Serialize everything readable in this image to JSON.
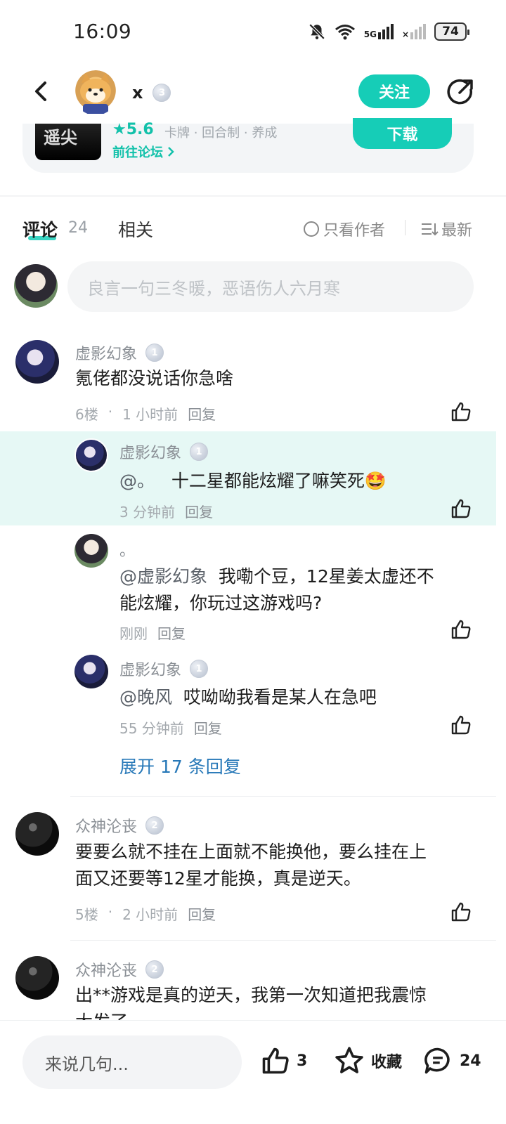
{
  "status": {
    "time": "16:09",
    "network": "5G",
    "battery": "74"
  },
  "header": {
    "user_name": "x",
    "level": "3",
    "follow_label": "关注"
  },
  "game": {
    "thumb_text": "遥尖",
    "rating": "★5.6",
    "tags": "卡牌 · 回合制 · 养成",
    "forum_link": "前往论坛",
    "download_label": "下载"
  },
  "tabs": {
    "comments_label": "评论",
    "comments_count": "24",
    "related_label": "相关",
    "author_only_label": "只看作者",
    "sort_label": "最新"
  },
  "composer": {
    "placeholder": "良言一句三冬暖，恶语伤人六月寒"
  },
  "comments": [
    {
      "user": "虚影幻象",
      "level": "1",
      "text": "氪佬都没说话你急啥",
      "floor": "6楼",
      "time": "1 小时前",
      "reply": "回复",
      "replies": [
        {
          "user": "虚影幻象",
          "level": "1",
          "mention": "@。",
          "text": "十二星都能炫耀了嘛笑死🤩",
          "time": "3 分钟前",
          "reply": "回复"
        },
        {
          "user": "。",
          "mention": "@虚影幻象",
          "text_line1": "我嘞个豆，12星姜太虚还不",
          "text_line2": "能炫耀，你玩过这游戏吗?",
          "time": "刚刚",
          "reply": "回复"
        },
        {
          "user": "虚影幻象",
          "level": "1",
          "mention": "@晚风",
          "text": "哎呦呦我看是某人在急吧",
          "time": "55 分钟前",
          "reply": "回复"
        }
      ],
      "expand_label": "展开 17 条回复"
    },
    {
      "user": "众神沦丧",
      "level": "2",
      "text_line1": "要要么就不挂在上面就不能换他，要么挂在上",
      "text_line2": "面又还要等12星才能换，真是逆天。",
      "floor": "5楼",
      "time": "2 小时前",
      "reply": "回复"
    },
    {
      "user": "众神沦丧",
      "level": "2",
      "text_line1": "出**游戏是真的逆天，我第一次知道把我震惊",
      "text_line2": "大发了"
    }
  ],
  "bottom_bar": {
    "input_placeholder": "来说几句...",
    "like_count": "3",
    "favorite_label": "收藏",
    "comment_count": "24"
  },
  "colors": {
    "accent": "#16cdb7",
    "link": "#2778b8",
    "highlight": "#e6f8f5"
  }
}
